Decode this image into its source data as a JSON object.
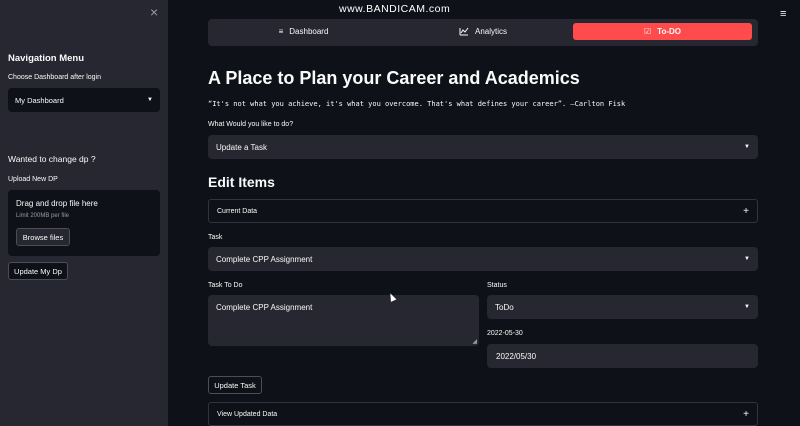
{
  "sidebar": {
    "close_icon": "×",
    "title": "Navigation Menu",
    "dashboard_label": "Choose Dashboard after login",
    "dashboard_value": "My Dashboard",
    "change_dp_heading": "Wanted to change dp ?",
    "upload_label": "Upload New DP",
    "dropzone_title": "Drag and drop file here",
    "dropzone_limit": "Limit 200MB per file",
    "browse_button": "Browse files",
    "update_button": "Update My Dp"
  },
  "header": {
    "menu_icon": "≡",
    "watermark": "www.BANDICAM.com"
  },
  "nav": {
    "items": [
      {
        "label": "Dashboard",
        "icon": "≡"
      },
      {
        "label": "Analytics",
        "icon": "📈"
      },
      {
        "label": "To-DO",
        "icon": "☑"
      }
    ],
    "active_color": "#ff4b4b"
  },
  "main": {
    "title": "A Place to Plan your Career and Academics",
    "quote": "“It's not what you achieve, it's what you overcome. That's what defines your career”. —Carlton Fisk",
    "action_label": "What Would you like to do?",
    "action_value": "Update a Task",
    "edit_title": "Edit Items",
    "current_data_expander": "Current Data",
    "task_label": "Task",
    "task_value": "Complete CPP Assignment",
    "task_todo_label": "Task To Do",
    "task_todo_value": "Complete CPP Assignment",
    "status_label": "Status",
    "status_value": "ToDo",
    "date_label": "2022-05-30",
    "date_value": "2022/05/30",
    "update_button": "Update Task",
    "view_updated_expander": "View Updated Data",
    "expand_icon": "+"
  },
  "colors": {
    "background": "#0e1117",
    "sidebar": "#262730",
    "accent": "#ff4b4b"
  }
}
